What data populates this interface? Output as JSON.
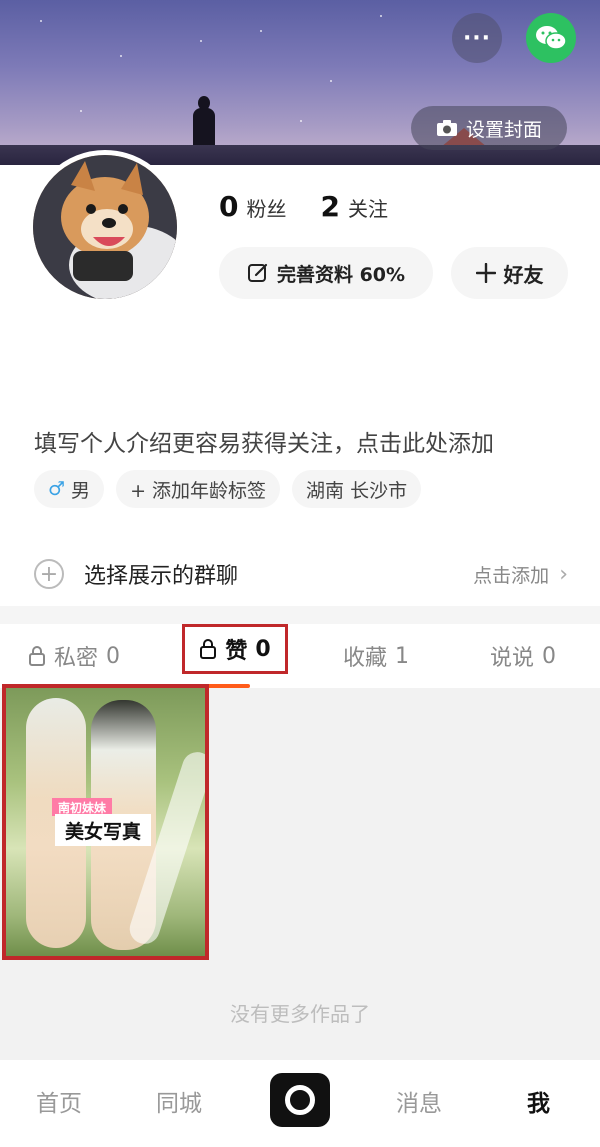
{
  "cover": {
    "set_cover_label": "设置封面"
  },
  "header": {
    "more_label": "···"
  },
  "profile": {
    "followers_count": "0",
    "followers_label": "粉丝",
    "following_count": "2",
    "following_label": "关注",
    "edit_profile_label": "完善资料 60%",
    "add_friend_label": "好友",
    "intro_placeholder": "填写个人介绍更容易获得关注，点击此处添加",
    "tags": {
      "gender_symbol": "♂",
      "gender": "男",
      "age_tag": "+ 添加年龄标签",
      "location": "湖南 长沙市"
    }
  },
  "group_chat": {
    "label": "选择展示的群聊",
    "action": "点击添加",
    "chevron": "›"
  },
  "tabs": [
    {
      "label": "私密",
      "count": "0"
    },
    {
      "label": "赞",
      "count": "0"
    },
    {
      "label": "收藏",
      "count": "1"
    },
    {
      "label": "说说",
      "count": "0"
    }
  ],
  "active_tab": "赞",
  "content": {
    "card_tag": "南初妹妹",
    "card_title": "美女写真",
    "end_text": "没有更多作品了"
  },
  "bottom_nav": {
    "home": "首页",
    "city": "同城",
    "messages": "消息",
    "me": "我"
  },
  "colors": {
    "accent": "#ff5b1a",
    "highlight_box": "#c0282a",
    "wechat_green": "#2dc161"
  }
}
